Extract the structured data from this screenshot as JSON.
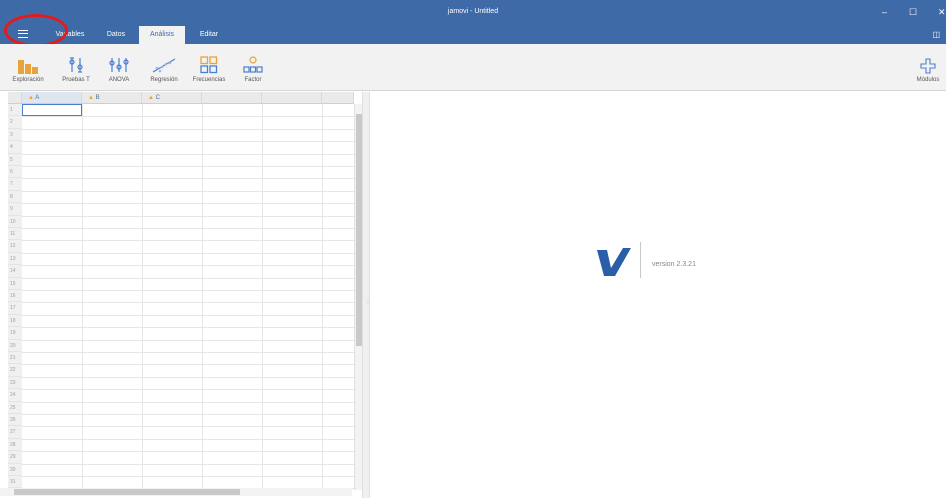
{
  "window": {
    "title": "jamovi - Untitled",
    "minimize": "–",
    "maximize": "☐",
    "close": "✕"
  },
  "menu_icon": "hamburger-menu-icon",
  "tabs": [
    {
      "label": "Variables",
      "active": false
    },
    {
      "label": "Datos",
      "active": false
    },
    {
      "label": "Análisis",
      "active": true
    },
    {
      "label": "Editar",
      "active": false
    }
  ],
  "ribbon": {
    "buttons": [
      {
        "label": "Exploración",
        "icon": "bar-chart-icon"
      },
      {
        "label": "Pruebas T",
        "icon": "t-test-icon"
      },
      {
        "label": "ANOVA",
        "icon": "anova-icon"
      },
      {
        "label": "Regresión",
        "icon": "regression-icon"
      },
      {
        "label": "Frecuencias",
        "icon": "frequencies-icon"
      },
      {
        "label": "Factor",
        "icon": "factor-icon"
      }
    ],
    "modules": {
      "label": "Módulos",
      "icon": "plus-icon"
    }
  },
  "spreadsheet": {
    "columns": [
      "A",
      "B",
      "C"
    ],
    "row_numbers": [
      "1",
      "2",
      "3",
      "4",
      "5",
      "6",
      "7",
      "8",
      "9",
      "10",
      "11",
      "12",
      "13",
      "14",
      "15",
      "16",
      "17",
      "18",
      "19",
      "20",
      "21",
      "22",
      "23",
      "24",
      "25",
      "26",
      "27",
      "28",
      "29",
      "30",
      "31"
    ]
  },
  "results": {
    "version": "version 2.3.21",
    "logo_color": "#2a5ea8"
  },
  "colors": {
    "titlebar": "#3e6aa8",
    "ribbon": "#f2f2f2",
    "annotation_circle": "#e41b1b"
  }
}
